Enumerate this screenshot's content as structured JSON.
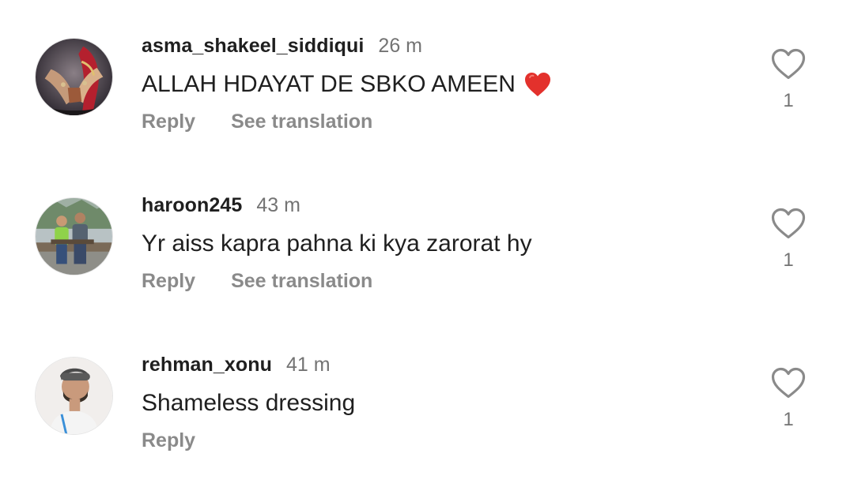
{
  "comments": [
    {
      "username": "asma_shakeel_siddiqui",
      "timestamp": "26 m",
      "text": "ALLAH HDAYAT DE SBKO AMEEN",
      "emoji": "red-heart",
      "actions": {
        "reply": "Reply",
        "translate": "See translation"
      },
      "likes": "1"
    },
    {
      "username": "haroon245",
      "timestamp": "43 m",
      "text": "Yr aiss kapra pahna ki kya zarorat hy",
      "actions": {
        "reply": "Reply",
        "translate": "See translation"
      },
      "likes": "1"
    },
    {
      "username": "rehman_xonu",
      "timestamp": "41 m",
      "text": "Shameless dressing",
      "actions": {
        "reply": "Reply"
      },
      "likes": "1"
    }
  ],
  "colors": {
    "username": "#1f1f1f",
    "muted": "#737373",
    "action": "#8a8a8a",
    "heart_outline": "#8a8a8a",
    "emoji_heart": "#e3312c"
  },
  "icons": {
    "like": "heart-outline-icon",
    "emoji": "red-heart-emoji"
  }
}
